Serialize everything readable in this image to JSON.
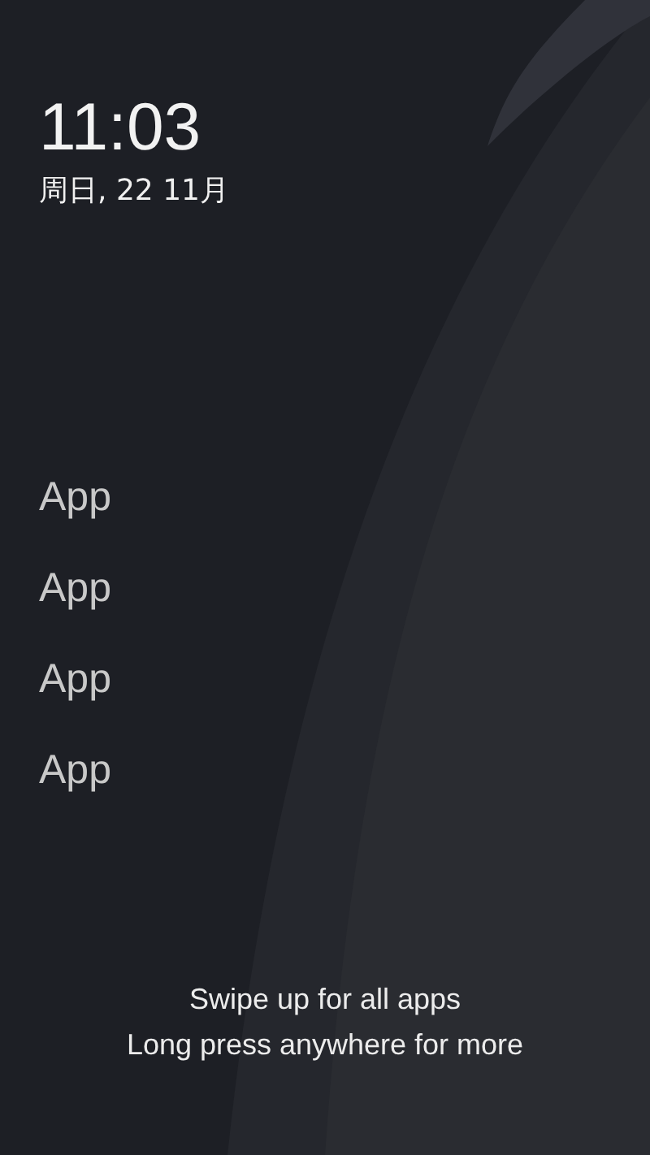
{
  "clock": {
    "time": "11:03",
    "date": "周日, 22 11月"
  },
  "apps": [
    {
      "label": "App"
    },
    {
      "label": "App"
    },
    {
      "label": "App"
    },
    {
      "label": "App"
    }
  ],
  "hints": [
    "Swipe up for all apps",
    "Long press anywhere for more"
  ]
}
